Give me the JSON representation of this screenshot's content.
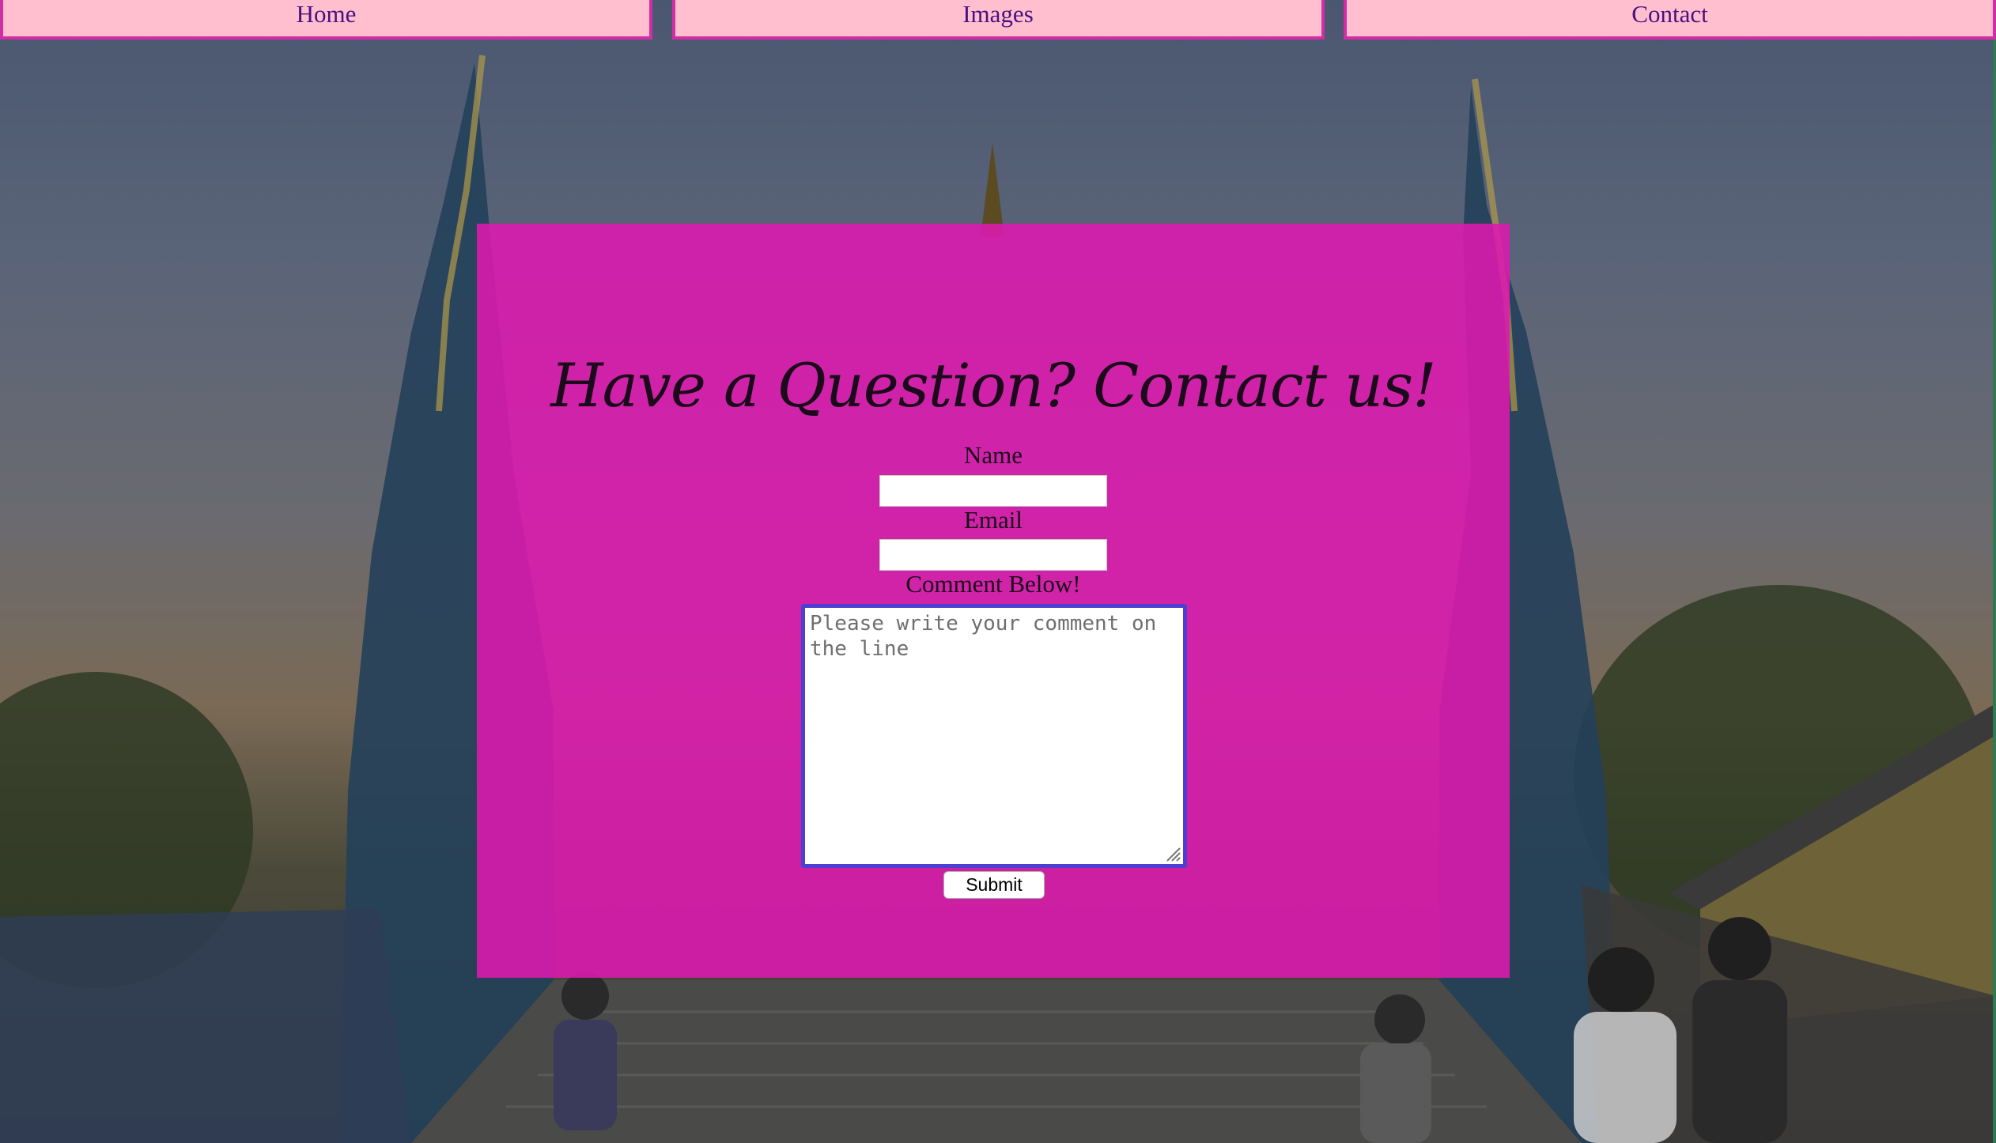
{
  "nav": {
    "items": [
      {
        "label": "Home"
      },
      {
        "label": "Images"
      },
      {
        "label": "Contact"
      }
    ]
  },
  "form": {
    "heading": "Have a Question? Contact us!",
    "name_label": "Name",
    "name_value": "",
    "email_label": "Email",
    "email_value": "",
    "comment_label": "Comment Below!",
    "comment_placeholder": "Please write your comment on the line",
    "submit_label": "Submit"
  },
  "colors": {
    "nav_background": "#ffbfcf",
    "nav_border": "#d12ea6",
    "nav_text": "#4a1080",
    "panel": "#de19b0",
    "comment_focus_border": "#4e3fd3"
  }
}
